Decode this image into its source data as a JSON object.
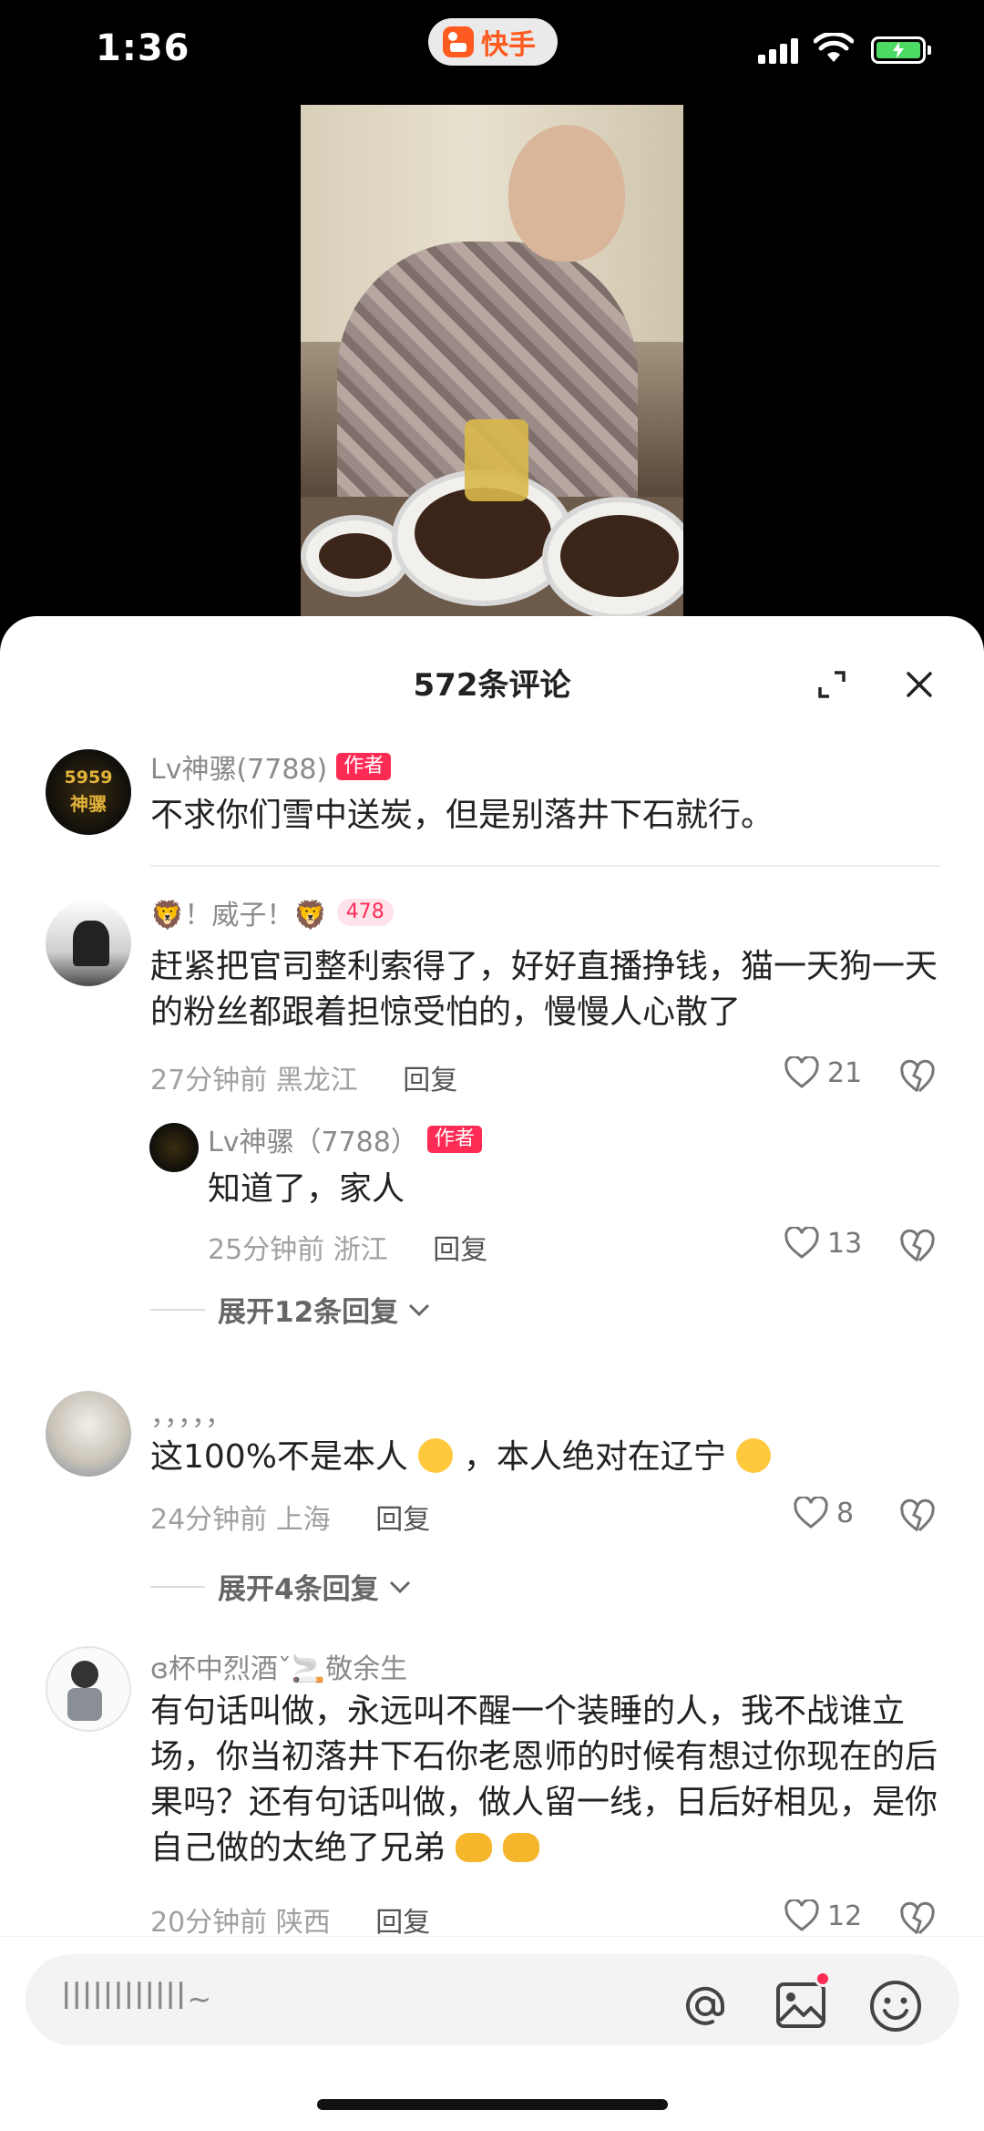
{
  "status_bar": {
    "time": "1:36",
    "app_name": "快手"
  },
  "sheet": {
    "title": "572条评论"
  },
  "comments": [
    {
      "username": "Lv神骡(7788)",
      "author_badge": "作者",
      "avatar_text_top": "5959",
      "avatar_text_bottom": "神骡",
      "text": "不求你们雪中送炭，但是别落井下石就行。"
    },
    {
      "username": "🦁！威子！🦁",
      "level_badge": "478",
      "text": "赶紧把官司整利索得了，好好直播挣钱，猫一天狗一天的粉丝都跟着担惊受怕的，慢慢人心散了",
      "time": "27分钟前",
      "location": "黑龙江",
      "reply_label": "回复",
      "likes": "21",
      "reply": {
        "username": "Lv神骡（7788）",
        "author_badge": "作者",
        "text": "知道了，家人",
        "time": "25分钟前",
        "location": "浙江",
        "reply_label": "回复",
        "likes": "13"
      },
      "expand_label": "展开12条回复"
    },
    {
      "username": "，，，，，",
      "text_before": "这100%不是本人",
      "text_middle": "，本人绝对在辽宁",
      "time": "24分钟前",
      "location": "上海",
      "reply_label": "回复",
      "likes": "8",
      "expand_label": "展开4条回复"
    },
    {
      "username": "ɞ杯中烈酒ˇ🚬敬余生",
      "text": "有句话叫做，永远叫不醒一个装睡的人，我不战谁立场，你当初落井下石你老恩师的时候有想过你现在的后果吗？还有句话叫做，做人留一线，日后好相见，是你自己做的太绝了兄弟",
      "time": "20分钟前",
      "location": "陕西",
      "reply_label": "回复",
      "likes": "12"
    }
  ],
  "input": {
    "placeholder": "ꟾꟾꟾꟾꟾꟾꟾꟾꟾꟾꟾꟾ~"
  },
  "icons": {
    "expand": "expand-icon",
    "close": "close-icon",
    "like": "heart-icon",
    "dislike": "broken-heart-icon",
    "at": "at-icon",
    "image": "image-icon",
    "emoji": "smile-icon"
  },
  "colors": {
    "accent": "#fe2c55",
    "app_brand": "#ff5a1f",
    "battery": "#4cd964"
  }
}
